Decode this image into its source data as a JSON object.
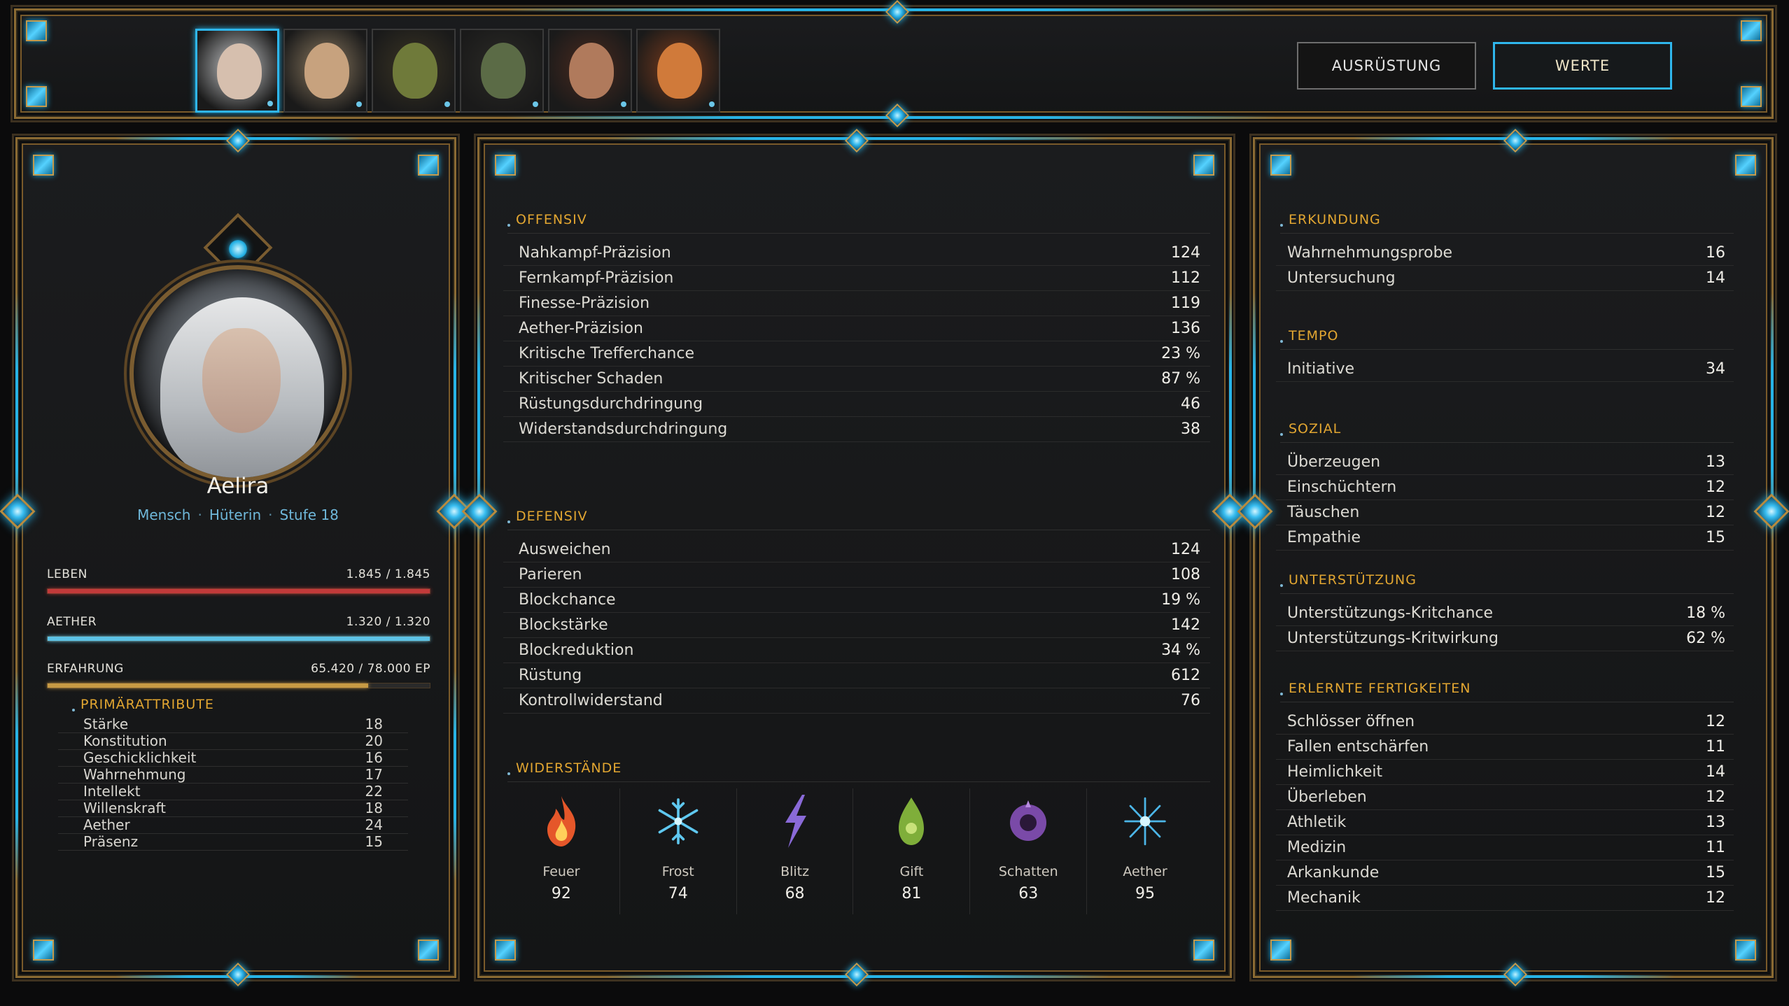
{
  "party": {
    "portraits": [
      {
        "name": "portrait-aelira",
        "active": true,
        "colors": [
          "#c9cbcd",
          "#d6bfae"
        ]
      },
      {
        "name": "portrait-elf",
        "active": false,
        "colors": [
          "#8c7a60",
          "#c7a27e"
        ]
      },
      {
        "name": "portrait-goblin",
        "active": false,
        "colors": [
          "#3a3424",
          "#6f7a3a"
        ]
      },
      {
        "name": "portrait-orc",
        "active": false,
        "colors": [
          "#2b2a26",
          "#5b6b46"
        ]
      },
      {
        "name": "portrait-druid",
        "active": false,
        "colors": [
          "#4a2a1f",
          "#b07a5c"
        ]
      },
      {
        "name": "portrait-dwarf",
        "active": false,
        "colors": [
          "#7a3b1c",
          "#d07a3a"
        ]
      }
    ]
  },
  "tabs": {
    "equipment": "AUSRÜSTUNG",
    "stats": "WERTE",
    "active": "stats"
  },
  "character": {
    "name": "Aelira",
    "race": "Mensch",
    "class": "Hüterin",
    "level": "Stufe 18",
    "sep": "·"
  },
  "bars": [
    {
      "label": "LEBEN",
      "value": "1.845 / 1.845",
      "fraction": 1.0,
      "color": "#c23a3a"
    },
    {
      "label": "AETHER",
      "value": "1.320 / 1.320",
      "fraction": 1.0,
      "color": "#5cc2e6"
    },
    {
      "label": "ERFAHRUNG",
      "value": "65.420 / 78.000 EP",
      "fraction": 0.839,
      "color": "#c79a44"
    }
  ],
  "primary": {
    "title": "PRIMÄRATTRIBUTE",
    "rows": [
      {
        "name": "Stärke",
        "value": "18"
      },
      {
        "name": "Konstitution",
        "value": "20"
      },
      {
        "name": "Geschicklichkeit",
        "value": "16"
      },
      {
        "name": "Wahrnehmung",
        "value": "17"
      },
      {
        "name": "Intellekt",
        "value": "22"
      },
      {
        "name": "Willenskraft",
        "value": "18"
      },
      {
        "name": "Aether",
        "value": "24"
      },
      {
        "name": "Präsenz",
        "value": "15"
      }
    ]
  },
  "offensive": {
    "title": "OFFENSIV",
    "rows": [
      {
        "name": "Nahkampf-Präzision",
        "value": "124"
      },
      {
        "name": "Fernkampf-Präzision",
        "value": "112"
      },
      {
        "name": "Finesse-Präzision",
        "value": "119"
      },
      {
        "name": "Aether-Präzision",
        "value": "136"
      },
      {
        "name": "Kritische Trefferchance",
        "value": "23 %"
      },
      {
        "name": "Kritischer Schaden",
        "value": "87 %"
      },
      {
        "name": "Rüstungsdurchdringung",
        "value": "46"
      },
      {
        "name": "Widerstandsdurchdringung",
        "value": "38"
      }
    ]
  },
  "defensive": {
    "title": "DEFENSIV",
    "rows": [
      {
        "name": "Ausweichen",
        "value": "124"
      },
      {
        "name": "Parieren",
        "value": "108"
      },
      {
        "name": "Blockchance",
        "value": "19 %"
      },
      {
        "name": "Blockstärke",
        "value": "142"
      },
      {
        "name": "Blockreduktion",
        "value": "34 %"
      },
      {
        "name": "Rüstung",
        "value": "612"
      },
      {
        "name": "Kontrollwiderstand",
        "value": "76"
      }
    ]
  },
  "resistances": {
    "title": "WIDERSTÄNDE",
    "items": [
      {
        "name": "Feuer",
        "value": "92",
        "icon": "fire-icon",
        "color": "#e5572a"
      },
      {
        "name": "Frost",
        "value": "74",
        "icon": "snowflake-icon",
        "color": "#5fc8f0"
      },
      {
        "name": "Blitz",
        "value": "68",
        "icon": "lightning-icon",
        "color": "#8a6ad8"
      },
      {
        "name": "Gift",
        "value": "81",
        "icon": "poison-icon",
        "color": "#7fae3a"
      },
      {
        "name": "Schatten",
        "value": "63",
        "icon": "shadow-icon",
        "color": "#7a4aa8"
      },
      {
        "name": "Aether",
        "value": "95",
        "icon": "aether-icon",
        "color": "#4cb6e8"
      }
    ]
  },
  "exploration": {
    "title": "ERKUNDUNG",
    "rows": [
      {
        "name": "Wahrnehmungsprobe",
        "value": "16"
      },
      {
        "name": "Untersuchung",
        "value": "14"
      }
    ]
  },
  "tempo": {
    "title": "TEMPO",
    "rows": [
      {
        "name": "Initiative",
        "value": "34"
      }
    ]
  },
  "social": {
    "title": "SOZIAL",
    "rows": [
      {
        "name": "Überzeugen",
        "value": "13"
      },
      {
        "name": "Einschüchtern",
        "value": "12"
      },
      {
        "name": "Täuschen",
        "value": "12"
      },
      {
        "name": "Empathie",
        "value": "15"
      }
    ]
  },
  "support": {
    "title": "UNTERSTÜTZUNG",
    "rows": [
      {
        "name": "Unterstützungs-Kritchance",
        "value": "18 %"
      },
      {
        "name": "Unterstützungs-Kritwirkung",
        "value": "62 %"
      }
    ]
  },
  "skills": {
    "title": "ERLERNTE FERTIGKEITEN",
    "rows": [
      {
        "name": "Schlösser öffnen",
        "value": "12"
      },
      {
        "name": "Fallen entschärfen",
        "value": "11"
      },
      {
        "name": "Heimlichkeit",
        "value": "14"
      },
      {
        "name": "Überleben",
        "value": "12"
      },
      {
        "name": "Athletik",
        "value": "13"
      },
      {
        "name": "Medizin",
        "value": "11"
      },
      {
        "name": "Arkankunde",
        "value": "15"
      },
      {
        "name": "Mechanik",
        "value": "12"
      }
    ]
  }
}
